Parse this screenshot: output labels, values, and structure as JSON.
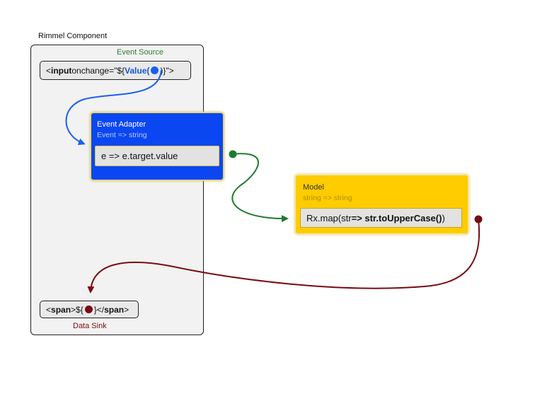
{
  "component": {
    "title": "Rimmel Component"
  },
  "event_source": {
    "label": "Event Source",
    "code": {
      "prefix": "<",
      "tag": "input",
      "attr": " onchange=\"${",
      "fn": "Value(",
      "suffix": ")}\">"
    }
  },
  "adapter": {
    "title": "Event Adapter",
    "signature": "Event => string",
    "code": "e => e.target.value"
  },
  "model": {
    "title": "Model",
    "signature": "string => string",
    "code": {
      "prefix": "Rx.map(str ",
      "bold": "=> str.toUpperCase()",
      "suffix": ")"
    }
  },
  "data_sink": {
    "label": "Data Sink",
    "code": {
      "open": "<",
      "tag1": "span",
      "mid": ">${",
      "after": "}</",
      "tag2": "span",
      "close": ">"
    }
  },
  "colors": {
    "blue_flow": "#1a5ff2",
    "green_flow": "#1e7a2e",
    "red_flow": "#7a0b12",
    "adapter_bg": "#0a47f2",
    "model_bg": "#ffcc00"
  }
}
